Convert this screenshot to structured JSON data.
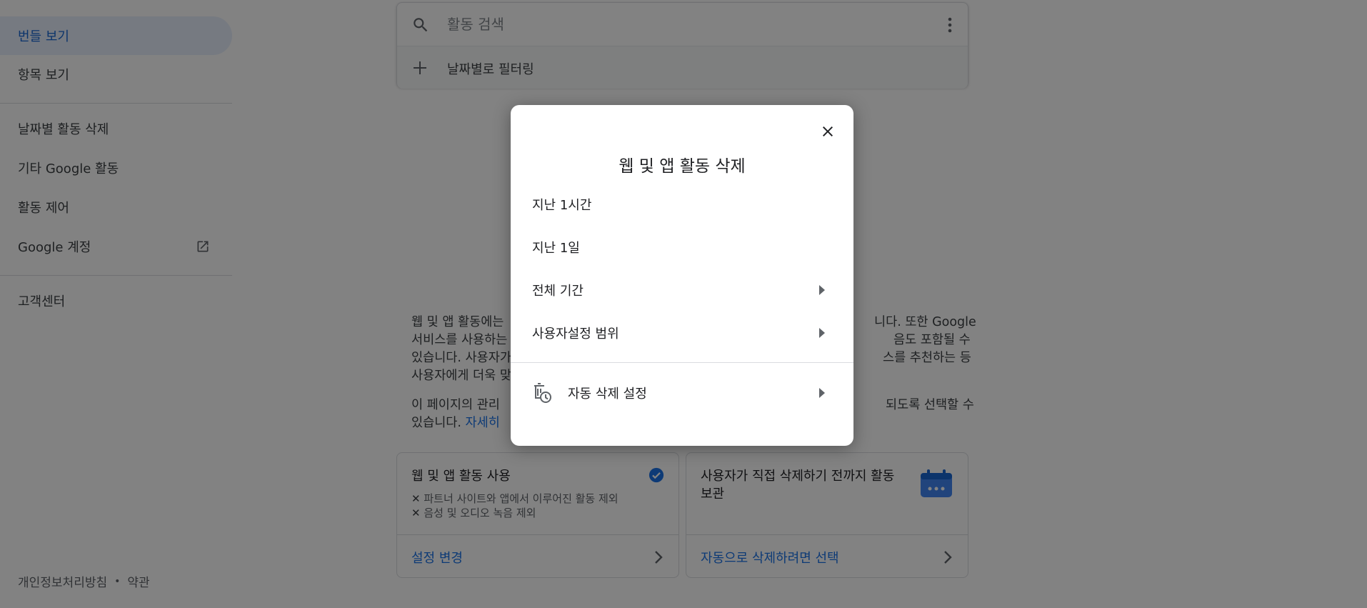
{
  "sidebar": {
    "items": [
      {
        "label": "번들 보기"
      },
      {
        "label": "항목 보기"
      },
      {
        "label": "날짜별 활동 삭제"
      },
      {
        "label": "기타 Google 활동"
      },
      {
        "label": "활동 제어"
      },
      {
        "label": "Google 계정"
      },
      {
        "label": "고객센터"
      }
    ],
    "footer": {
      "privacy": "개인정보처리방침",
      "separator": "•",
      "terms": "약관"
    }
  },
  "search": {
    "placeholder": "활동 검색",
    "filter_label": "날짜별로 필터링"
  },
  "description": {
    "para1_lines": [
      "웹 및 앱 활동에는",
      "서비스를 사용하는",
      "있습니다. 사용자가",
      "사용자에게 더욱 맞"
    ],
    "para1_right_lines": [
      "니다. 또한 Google",
      "음도 포함될 수",
      "스를 추천하는 등",
      ""
    ],
    "para2_line1_left": "이 페이지의 관리",
    "para2_line1_right": "되도록 선택할 수",
    "para2_line2_text": "있습니다. ",
    "para2_link": "자세히"
  },
  "cards": [
    {
      "title": "웹 및 앱 활동 사용",
      "exclusions": [
        "파트너 사이트와 앱에서 이루어진 활동 제외",
        "음성 및 오디오 녹음 제외"
      ],
      "link": "설정 변경"
    },
    {
      "title_line1": "사용자가 직접 삭제하기 전까지 활동",
      "title_line2": "보관",
      "link": "자동으로 삭제하려면 선택"
    }
  ],
  "dialog": {
    "title": "웹 및 앱 활동 삭제",
    "options": [
      {
        "label": "지난 1시간"
      },
      {
        "label": "지난 1일"
      },
      {
        "label": "전체 기간"
      },
      {
        "label": "사용자설정 범위"
      }
    ],
    "auto_delete": "자동 삭제 설정"
  },
  "colors": {
    "accent": "#1a73e8",
    "active_bg": "#e8f0fe",
    "scrim": "rgba(0,0,0,0.49)"
  },
  "icons": [
    "search-icon",
    "more-vert-icon",
    "plus-icon",
    "open-in-new-icon",
    "check-circle-icon",
    "calendar-icon",
    "chevron-right-icon",
    "close-icon",
    "caret-right-icon",
    "auto-delete-icon"
  ]
}
